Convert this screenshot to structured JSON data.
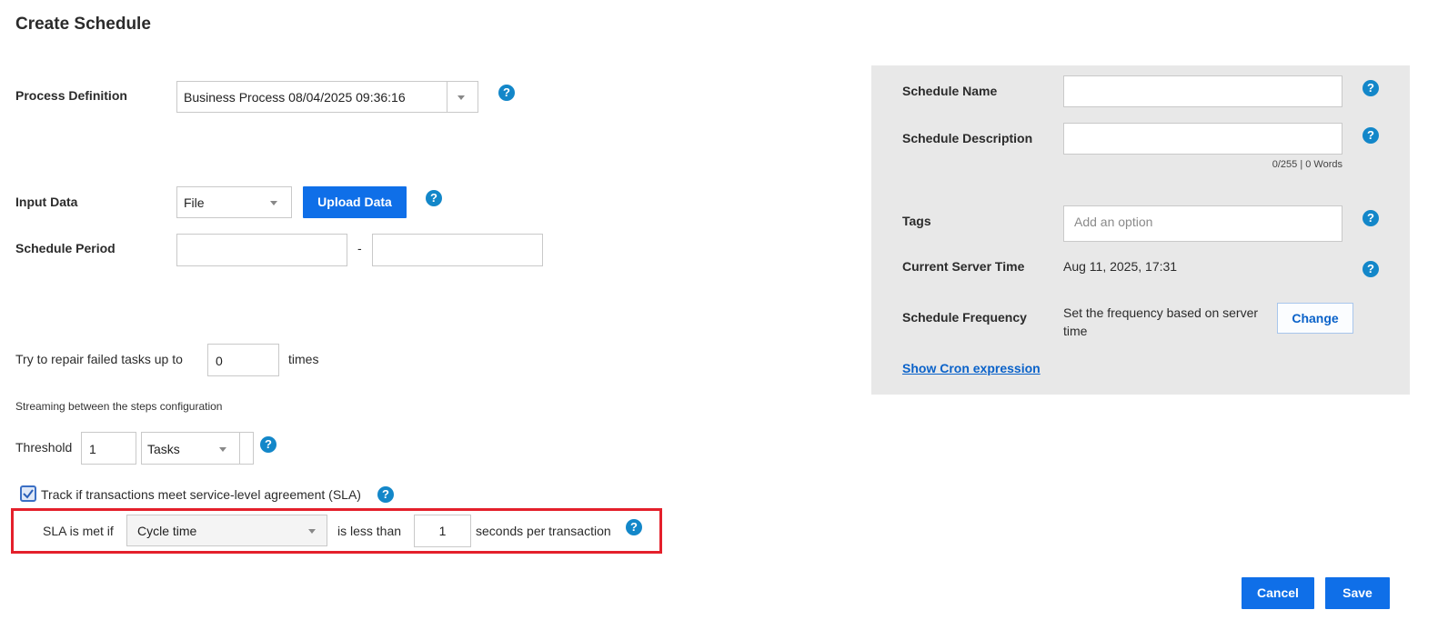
{
  "page": {
    "title": "Create Schedule"
  },
  "left": {
    "process_definition": {
      "label": "Process Definition",
      "value": "Business Process 08/04/2025 09:36:16"
    },
    "input_data": {
      "label": "Input Data",
      "select_value": "File",
      "upload_label": "Upload Data"
    },
    "schedule_period": {
      "label": "Schedule Period",
      "separator": "-",
      "start": "",
      "end": ""
    },
    "repair": {
      "prefix": "Try to repair failed tasks up to",
      "value": "0",
      "suffix": "times"
    },
    "streaming": {
      "heading": "Streaming between the steps configuration"
    },
    "threshold": {
      "label": "Threshold",
      "value": "1",
      "unit": "Tasks"
    },
    "sla": {
      "checkbox_label": "Track if transactions meet service-level agreement (SLA)",
      "checked": true,
      "prefix": "SLA is met if",
      "metric": "Cycle time",
      "comparison": "is less than",
      "value": "1",
      "suffix": "seconds per transaction"
    }
  },
  "right": {
    "schedule_name": {
      "label": "Schedule Name",
      "value": ""
    },
    "schedule_description": {
      "label": "Schedule Description",
      "value": "",
      "counter": "0/255 | 0 Words"
    },
    "tags": {
      "label": "Tags",
      "placeholder": "Add an option"
    },
    "server_time": {
      "label": "Current Server Time",
      "value": "Aug 11, 2025, 17:31"
    },
    "frequency": {
      "label": "Schedule Frequency",
      "text": "Set the frequency based on server time",
      "change_label": "Change"
    },
    "cron_link": "Show Cron expression"
  },
  "footer": {
    "cancel_label": "Cancel",
    "save_label": "Save"
  },
  "icons": {
    "help": "help-circle-icon",
    "dropdown": "caret-down-icon",
    "check": "checkmark-icon"
  },
  "colors": {
    "primary": "#0f6fe8",
    "help": "#1387c9",
    "highlight": "#e4202b",
    "panel": "#e8e8e8"
  }
}
